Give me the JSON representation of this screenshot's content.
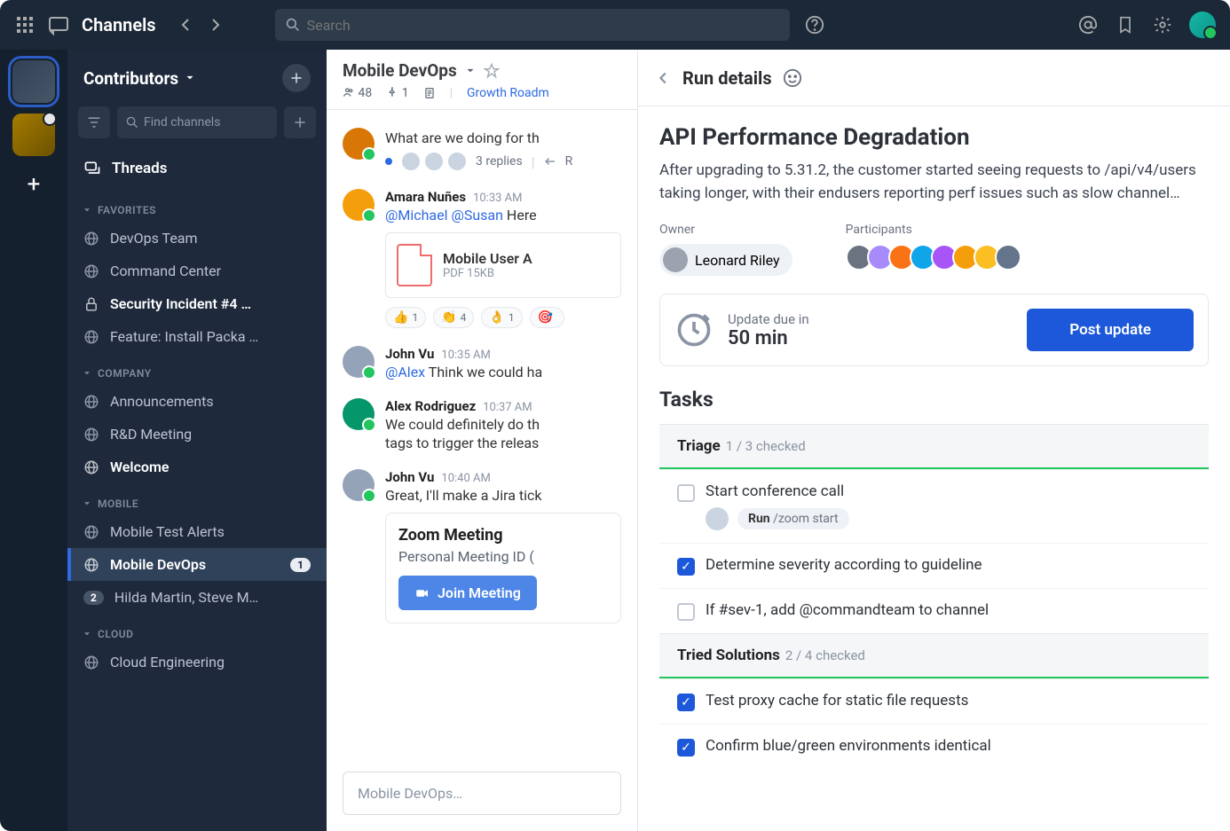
{
  "topbar": {
    "title": "Channels",
    "search_placeholder": "Search"
  },
  "team": {
    "name": "Contributors",
    "find_placeholder": "Find channels",
    "threads_label": "Threads"
  },
  "sections": {
    "favorites": "FAVORITES",
    "company": "COMPANY",
    "mobile": "MOBILE",
    "cloud": "CLOUD"
  },
  "channels": {
    "favorites": [
      {
        "name": "DevOps Team",
        "icon": "globe"
      },
      {
        "name": "Command Center",
        "icon": "globe"
      },
      {
        "name": "Security Incident #4 …",
        "icon": "lock",
        "bold": true
      },
      {
        "name": "Feature: Install Packa …",
        "icon": "globe"
      }
    ],
    "company": [
      {
        "name": "Announcements",
        "icon": "globe"
      },
      {
        "name": "R&D Meeting",
        "icon": "globe"
      },
      {
        "name": "Welcome",
        "icon": "globe",
        "bold": true
      }
    ],
    "mobile": [
      {
        "name": "Mobile Test Alerts",
        "icon": "globe"
      },
      {
        "name": "Mobile DevOps",
        "icon": "globe",
        "bold": true,
        "active": true,
        "badge": "1"
      },
      {
        "name": "Hilda Martin, Steve M…",
        "icon": "count",
        "badge_grey": "2"
      }
    ],
    "cloud": [
      {
        "name": "Cloud Engineering",
        "icon": "globe"
      }
    ]
  },
  "chat": {
    "title": "Mobile DevOps",
    "members": "48",
    "pinned": "1",
    "tab_link": "Growth Roadm",
    "compose_placeholder": "Mobile DevOps…",
    "messages": [
      {
        "author": "",
        "time": "",
        "text": "What are we doing for th",
        "thread_replies": "3 replies",
        "thread_tail": "R"
      },
      {
        "author": "Amara Nuñes",
        "time": "10:33 AM",
        "mention1": "@Michael",
        "mention2": "@Susan",
        "text_tail": " Here",
        "attach_title": "Mobile User A",
        "attach_sub": "PDF 15KB",
        "reactions": [
          {
            "emoji": "👍",
            "count": "1"
          },
          {
            "emoji": "👏",
            "count": "4"
          },
          {
            "emoji": "👌",
            "count": "1"
          },
          {
            "emoji": "🎯",
            "count": ""
          }
        ]
      },
      {
        "author": "John Vu",
        "time": "10:35 AM",
        "mention1": "@Alex",
        "text_tail": " Think we could ha"
      },
      {
        "author": "Alex Rodriguez",
        "time": "10:37 AM",
        "text": "We could definitely do th",
        "text2": "tags to trigger the releas"
      },
      {
        "author": "John Vu",
        "time": "10:40 AM",
        "text": "Great, I'll make a Jira tick",
        "zoom_title": "Zoom Meeting",
        "zoom_sub": "Personal Meeting ID (",
        "zoom_btn": "Join Meeting"
      }
    ]
  },
  "panel": {
    "title": "Run details",
    "run_title": "API Performance Degradation",
    "run_desc": "After upgrading to 5.31.2, the customer started seeing requests to /api/v4/users taking longer, with their endusers reporting perf issues such as slow channel…",
    "owner_label": "Owner",
    "owner_name": "Leonard Riley",
    "participants_label": "Participants",
    "participant_count": 8,
    "update_label": "Update due in",
    "update_value": "50 min",
    "post_update": "Post update",
    "tasks_title": "Tasks",
    "sections": [
      {
        "name": "Triage",
        "count": "1 / 3 checked",
        "items": [
          {
            "text": "Start conference call",
            "checked": false,
            "run_chip_label": "Run",
            "run_chip_cmd": "/zoom start",
            "has_sub": true
          },
          {
            "text": "Determine severity according to guideline",
            "checked": true
          },
          {
            "text": "If #sev-1, add @commandteam to channel",
            "checked": false
          }
        ]
      },
      {
        "name": "Tried Solutions",
        "count": "2 / 4 checked",
        "items": [
          {
            "text": "Test proxy cache for static file requests",
            "checked": true
          },
          {
            "text": "Confirm blue/green environments identical",
            "checked": true
          }
        ]
      }
    ]
  }
}
